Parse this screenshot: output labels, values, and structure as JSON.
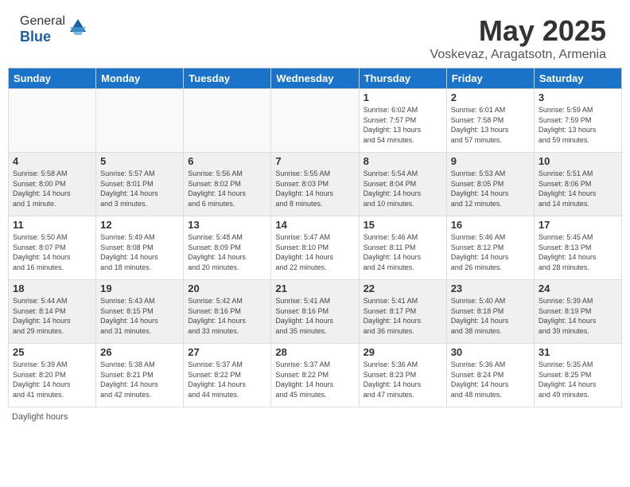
{
  "header": {
    "logo_general": "General",
    "logo_blue": "Blue",
    "title": "May 2025",
    "subtitle": "Voskevaz, Aragatsotn, Armenia"
  },
  "days_of_week": [
    "Sunday",
    "Monday",
    "Tuesday",
    "Wednesday",
    "Thursday",
    "Friday",
    "Saturday"
  ],
  "weeks": [
    [
      {
        "day": "",
        "info": ""
      },
      {
        "day": "",
        "info": ""
      },
      {
        "day": "",
        "info": ""
      },
      {
        "day": "",
        "info": ""
      },
      {
        "day": "1",
        "info": "Sunrise: 6:02 AM\nSunset: 7:57 PM\nDaylight: 13 hours\nand 54 minutes."
      },
      {
        "day": "2",
        "info": "Sunrise: 6:01 AM\nSunset: 7:58 PM\nDaylight: 13 hours\nand 57 minutes."
      },
      {
        "day": "3",
        "info": "Sunrise: 5:59 AM\nSunset: 7:59 PM\nDaylight: 13 hours\nand 59 minutes."
      }
    ],
    [
      {
        "day": "4",
        "info": "Sunrise: 5:58 AM\nSunset: 8:00 PM\nDaylight: 14 hours\nand 1 minute."
      },
      {
        "day": "5",
        "info": "Sunrise: 5:57 AM\nSunset: 8:01 PM\nDaylight: 14 hours\nand 3 minutes."
      },
      {
        "day": "6",
        "info": "Sunrise: 5:56 AM\nSunset: 8:02 PM\nDaylight: 14 hours\nand 6 minutes."
      },
      {
        "day": "7",
        "info": "Sunrise: 5:55 AM\nSunset: 8:03 PM\nDaylight: 14 hours\nand 8 minutes."
      },
      {
        "day": "8",
        "info": "Sunrise: 5:54 AM\nSunset: 8:04 PM\nDaylight: 14 hours\nand 10 minutes."
      },
      {
        "day": "9",
        "info": "Sunrise: 5:53 AM\nSunset: 8:05 PM\nDaylight: 14 hours\nand 12 minutes."
      },
      {
        "day": "10",
        "info": "Sunrise: 5:51 AM\nSunset: 8:06 PM\nDaylight: 14 hours\nand 14 minutes."
      }
    ],
    [
      {
        "day": "11",
        "info": "Sunrise: 5:50 AM\nSunset: 8:07 PM\nDaylight: 14 hours\nand 16 minutes."
      },
      {
        "day": "12",
        "info": "Sunrise: 5:49 AM\nSunset: 8:08 PM\nDaylight: 14 hours\nand 18 minutes."
      },
      {
        "day": "13",
        "info": "Sunrise: 5:48 AM\nSunset: 8:09 PM\nDaylight: 14 hours\nand 20 minutes."
      },
      {
        "day": "14",
        "info": "Sunrise: 5:47 AM\nSunset: 8:10 PM\nDaylight: 14 hours\nand 22 minutes."
      },
      {
        "day": "15",
        "info": "Sunrise: 5:46 AM\nSunset: 8:11 PM\nDaylight: 14 hours\nand 24 minutes."
      },
      {
        "day": "16",
        "info": "Sunrise: 5:46 AM\nSunset: 8:12 PM\nDaylight: 14 hours\nand 26 minutes."
      },
      {
        "day": "17",
        "info": "Sunrise: 5:45 AM\nSunset: 8:13 PM\nDaylight: 14 hours\nand 28 minutes."
      }
    ],
    [
      {
        "day": "18",
        "info": "Sunrise: 5:44 AM\nSunset: 8:14 PM\nDaylight: 14 hours\nand 29 minutes."
      },
      {
        "day": "19",
        "info": "Sunrise: 5:43 AM\nSunset: 8:15 PM\nDaylight: 14 hours\nand 31 minutes."
      },
      {
        "day": "20",
        "info": "Sunrise: 5:42 AM\nSunset: 8:16 PM\nDaylight: 14 hours\nand 33 minutes."
      },
      {
        "day": "21",
        "info": "Sunrise: 5:41 AM\nSunset: 8:16 PM\nDaylight: 14 hours\nand 35 minutes."
      },
      {
        "day": "22",
        "info": "Sunrise: 5:41 AM\nSunset: 8:17 PM\nDaylight: 14 hours\nand 36 minutes."
      },
      {
        "day": "23",
        "info": "Sunrise: 5:40 AM\nSunset: 8:18 PM\nDaylight: 14 hours\nand 38 minutes."
      },
      {
        "day": "24",
        "info": "Sunrise: 5:39 AM\nSunset: 8:19 PM\nDaylight: 14 hours\nand 39 minutes."
      }
    ],
    [
      {
        "day": "25",
        "info": "Sunrise: 5:39 AM\nSunset: 8:20 PM\nDaylight: 14 hours\nand 41 minutes."
      },
      {
        "day": "26",
        "info": "Sunrise: 5:38 AM\nSunset: 8:21 PM\nDaylight: 14 hours\nand 42 minutes."
      },
      {
        "day": "27",
        "info": "Sunrise: 5:37 AM\nSunset: 8:22 PM\nDaylight: 14 hours\nand 44 minutes."
      },
      {
        "day": "28",
        "info": "Sunrise: 5:37 AM\nSunset: 8:22 PM\nDaylight: 14 hours\nand 45 minutes."
      },
      {
        "day": "29",
        "info": "Sunrise: 5:36 AM\nSunset: 8:23 PM\nDaylight: 14 hours\nand 47 minutes."
      },
      {
        "day": "30",
        "info": "Sunrise: 5:36 AM\nSunset: 8:24 PM\nDaylight: 14 hours\nand 48 minutes."
      },
      {
        "day": "31",
        "info": "Sunrise: 5:35 AM\nSunset: 8:25 PM\nDaylight: 14 hours\nand 49 minutes."
      }
    ]
  ],
  "footer": {
    "daylight_label": "Daylight hours"
  }
}
